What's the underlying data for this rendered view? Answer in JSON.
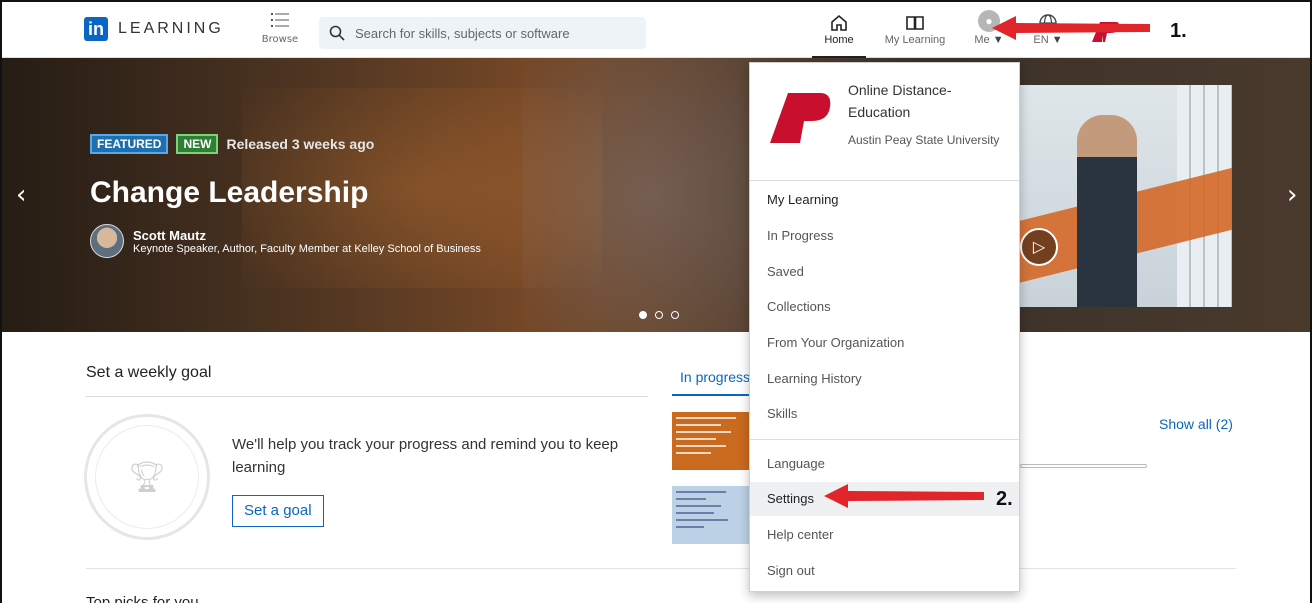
{
  "topnav": {
    "logo_text": "LEARNING",
    "logo_in": "in",
    "browse_label": "Browse",
    "search_placeholder": "Search for skills, subjects or software",
    "home_label": "Home",
    "my_learning_label": "My Learning",
    "me_label": "Me",
    "lang_label": "EN"
  },
  "hero": {
    "badge_featured": "FEATURED",
    "badge_new": "NEW",
    "released": "Released 3 weeks ago",
    "title": "Change Leadership",
    "author_name": "Scott Mautz",
    "author_role": "Keynote Speaker, Author, Faculty Member at Kelley School of Business",
    "slides_total": 3,
    "slide_active": 1
  },
  "goal": {
    "title": "Set a weekly goal",
    "text": "We'll help you track your progress and remind you to keep learning",
    "button": "Set a goal"
  },
  "progress_tab": {
    "label": "In progress",
    "show_all": "Show all (2)"
  },
  "next_section": {
    "title": "Top picks for you"
  },
  "dropdown": {
    "org_name": "Online Distance-Education",
    "org_university": "Austin Peay State University",
    "items_top": [
      "My Learning",
      "In Progress",
      "Saved",
      "Collections",
      "From Your Organization",
      "Learning History",
      "Skills"
    ],
    "items_bottom": [
      "Language",
      "Settings",
      "Help center",
      "Sign out"
    ],
    "active_item": "Settings"
  },
  "callouts": {
    "step1": "1.",
    "step2": "2."
  },
  "colors": {
    "brand_blue": "#0a66c2",
    "callout_red": "#e0252b",
    "ap_red": "#c8102e"
  }
}
